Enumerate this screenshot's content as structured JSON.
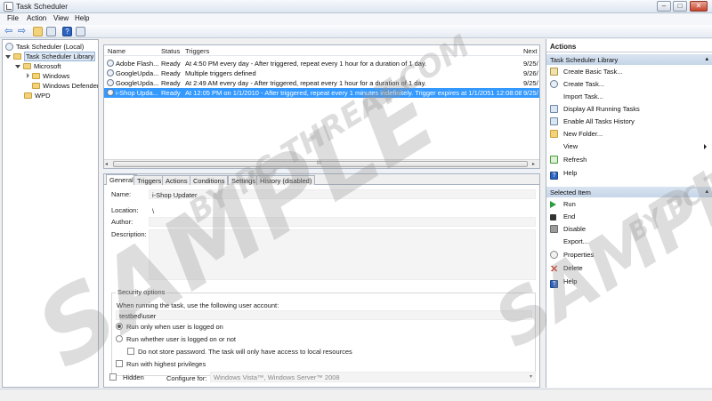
{
  "window": {
    "title": "Task Scheduler"
  },
  "menu": [
    "File",
    "Action",
    "View",
    "Help"
  ],
  "tree": {
    "root": "Task Scheduler (Local)",
    "library": "Task Scheduler Library",
    "microsoft": "Microsoft",
    "windows": "Windows",
    "defender": "Windows Defender",
    "wpd": "WPD"
  },
  "tasks": {
    "columns": [
      "Name",
      "Status",
      "Triggers",
      "Next R"
    ],
    "rows": [
      {
        "name": "Adobe Flash...",
        "status": "Ready",
        "triggers": "At 4:50 PM every day - After triggered, repeat every 1 hour for a duration of 1 day.",
        "next": "9/25/"
      },
      {
        "name": "GoogleUpda...",
        "status": "Ready",
        "triggers": "Multiple triggers defined",
        "next": "9/26/"
      },
      {
        "name": "GoogleUpda...",
        "status": "Ready",
        "triggers": "At 2:49 AM every day - After triggered, repeat every 1 hour for a duration of 1 day.",
        "next": "9/25/"
      },
      {
        "name": "i-Shop Upda...",
        "status": "Ready",
        "triggers": "At 12:05 PM on 1/1/2010 - After triggered, repeat every 1 minutes indefinitely. Trigger expires at 1/1/2051 12:08:08 PM.",
        "next": "9/25/"
      }
    ],
    "scroll_label": "III"
  },
  "details": {
    "tabs": [
      "General",
      "Triggers",
      "Actions",
      "Conditions",
      "Settings",
      "History (disabled)"
    ],
    "name_label": "Name:",
    "name_value": "i-Shop Updater",
    "location_label": "Location:",
    "location_value": "\\",
    "author_label": "Author:",
    "author_value": "",
    "description_label": "Description:",
    "security": {
      "title": "Security options",
      "account_label": "When running the task, use the following user account:",
      "account_value": "testbed\\user",
      "radio1": "Run only when user is logged on",
      "radio2": "Run whether user is logged on or not",
      "nostore": "Do not store password.  The task will only have access to local resources",
      "highest": "Run with highest privileges"
    },
    "hidden_label": "Hidden",
    "configure_label": "Configure for:",
    "configure_value": "Windows Vista™, Windows Server™ 2008"
  },
  "actions_pane": {
    "title": "Actions",
    "section1": "Task Scheduler Library",
    "items1": [
      "Create Basic Task...",
      "Create Task...",
      "Import Task...",
      "Display All Running Tasks",
      "Enable All Tasks History",
      "New Folder...",
      "View",
      "Refresh",
      "Help"
    ],
    "section2": "Selected Item",
    "items2": [
      "Run",
      "End",
      "Disable",
      "Export...",
      "Properties",
      "Delete",
      "Help"
    ]
  },
  "watermark": {
    "big": "SAMPLE",
    "small": "BY PC THREAT.COM"
  },
  "colors": {
    "selection": "#3399ff",
    "section_header": "#c6d5e8",
    "delete": "#d33a2a",
    "run": "#2e9b3c"
  }
}
